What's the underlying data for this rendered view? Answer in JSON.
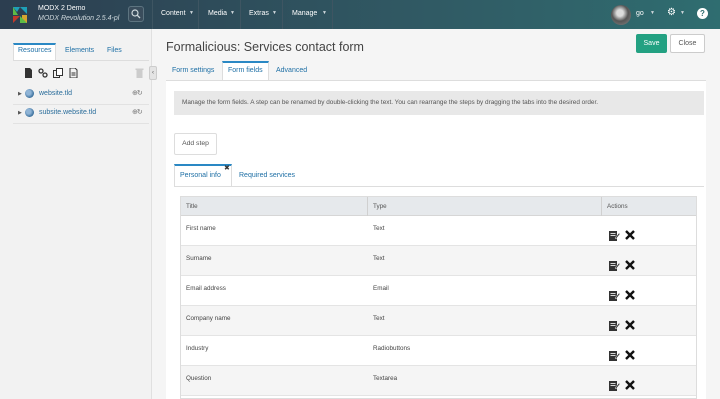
{
  "header": {
    "brand_title": "MODX 2 Demo",
    "brand_subtitle": "MODX Revolution 2.5.4-pl",
    "nav": [
      {
        "label": "Content"
      },
      {
        "label": "Media"
      },
      {
        "label": "Extras"
      },
      {
        "label": "Manage"
      }
    ],
    "user": "go",
    "help_glyph": "?"
  },
  "sidebar": {
    "tabs": [
      "Resources",
      "Elements",
      "Files"
    ],
    "tree": [
      {
        "label": "website.tld"
      },
      {
        "label": "subsite.website.tld"
      }
    ]
  },
  "main": {
    "title": "Formalicious: Services contact form",
    "save_label": "Save",
    "close_label": "Close",
    "tabs": [
      "Form settings",
      "Form fields",
      "Advanced"
    ],
    "info": "Manage the form fields. A step can be renamed by double-clicking the text. You can rearrange the steps by dragging the tabs into the desired order.",
    "add_step_label": "Add step",
    "steps": [
      "Personal info",
      "Required services"
    ]
  },
  "grid": {
    "columns": [
      "Title",
      "Type",
      "Actions"
    ],
    "rows": [
      {
        "title": "First name",
        "type": "Text"
      },
      {
        "title": "Surname",
        "type": "Text"
      },
      {
        "title": "Email address",
        "type": "Email"
      },
      {
        "title": "Company name",
        "type": "Text"
      },
      {
        "title": "Industry",
        "type": "Radiobuttons"
      },
      {
        "title": "Question",
        "type": "Textarea"
      }
    ]
  },
  "colors": {
    "accent": "#2a88c4",
    "save": "#23a182",
    "topbar": "#2f5563"
  },
  "icons": [
    "modx-logo-icon",
    "search-icon",
    "chevron-down-icon",
    "gear-icon",
    "help-icon",
    "document-icon",
    "link-icon",
    "copy-icon",
    "file-icon",
    "trash-icon",
    "globe-icon",
    "edit-icon",
    "delete-icon"
  ]
}
